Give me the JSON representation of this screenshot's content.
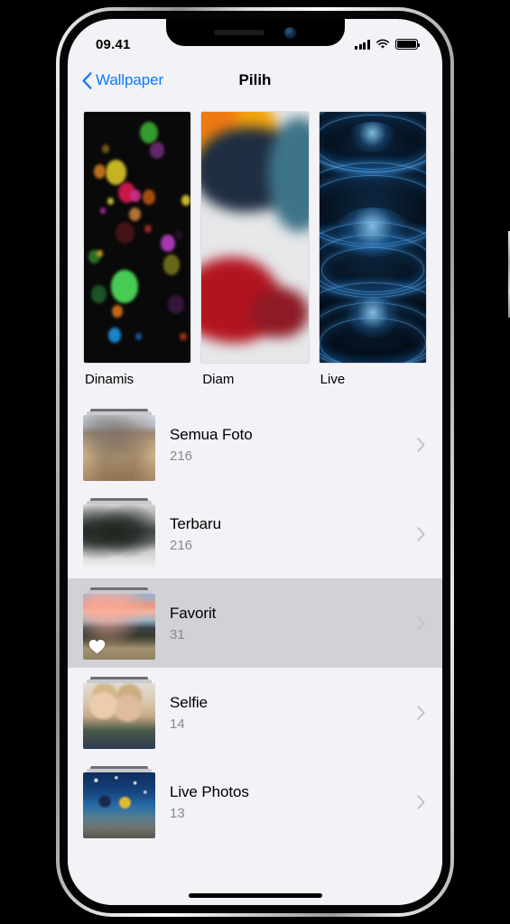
{
  "status_bar": {
    "time": "09.41",
    "signal_icon": "cellular-signal-icon",
    "wifi_icon": "wifi-icon",
    "battery_icon": "battery-full-icon"
  },
  "nav_bar": {
    "back_label": "Wallpaper",
    "back_icon": "chevron-left-icon",
    "title": "Pilih"
  },
  "wallpaper_categories": [
    {
      "label": "Dinamis",
      "thumb": "dynamic-bokeh-wallpaper"
    },
    {
      "label": "Diam",
      "thumb": "still-abstract-wallpaper"
    },
    {
      "label": "Live",
      "thumb": "live-blue-arcs-wallpaper"
    }
  ],
  "albums": [
    {
      "title": "Semua Foto",
      "count": "216",
      "thumb": "desert-landscape-thumbnail",
      "selected": false,
      "heart": false
    },
    {
      "title": "Terbaru",
      "count": "216",
      "thumb": "grayscale-landscape-thumbnail",
      "selected": false,
      "heart": false
    },
    {
      "title": "Favorit",
      "count": "31",
      "thumb": "sunset-landscape-thumbnail",
      "selected": true,
      "heart": true
    },
    {
      "title": "Selfie",
      "count": "14",
      "thumb": "two-boys-selfie-thumbnail",
      "selected": false,
      "heart": false
    },
    {
      "title": "Live Photos",
      "count": "13",
      "thumb": "beach-dusk-thumbnail",
      "selected": false,
      "heart": false
    }
  ],
  "chevron_icon": "chevron-right-icon",
  "heart_icon": "heart-filled-icon",
  "home_indicator": "home-indicator-bar",
  "colors": {
    "background": "#F2F2F7",
    "selected_row": "#D1D1D6",
    "accent_blue": "#0A7AFF",
    "secondary_text": "#8A8A8E",
    "chevron": "#C3C3C8"
  }
}
